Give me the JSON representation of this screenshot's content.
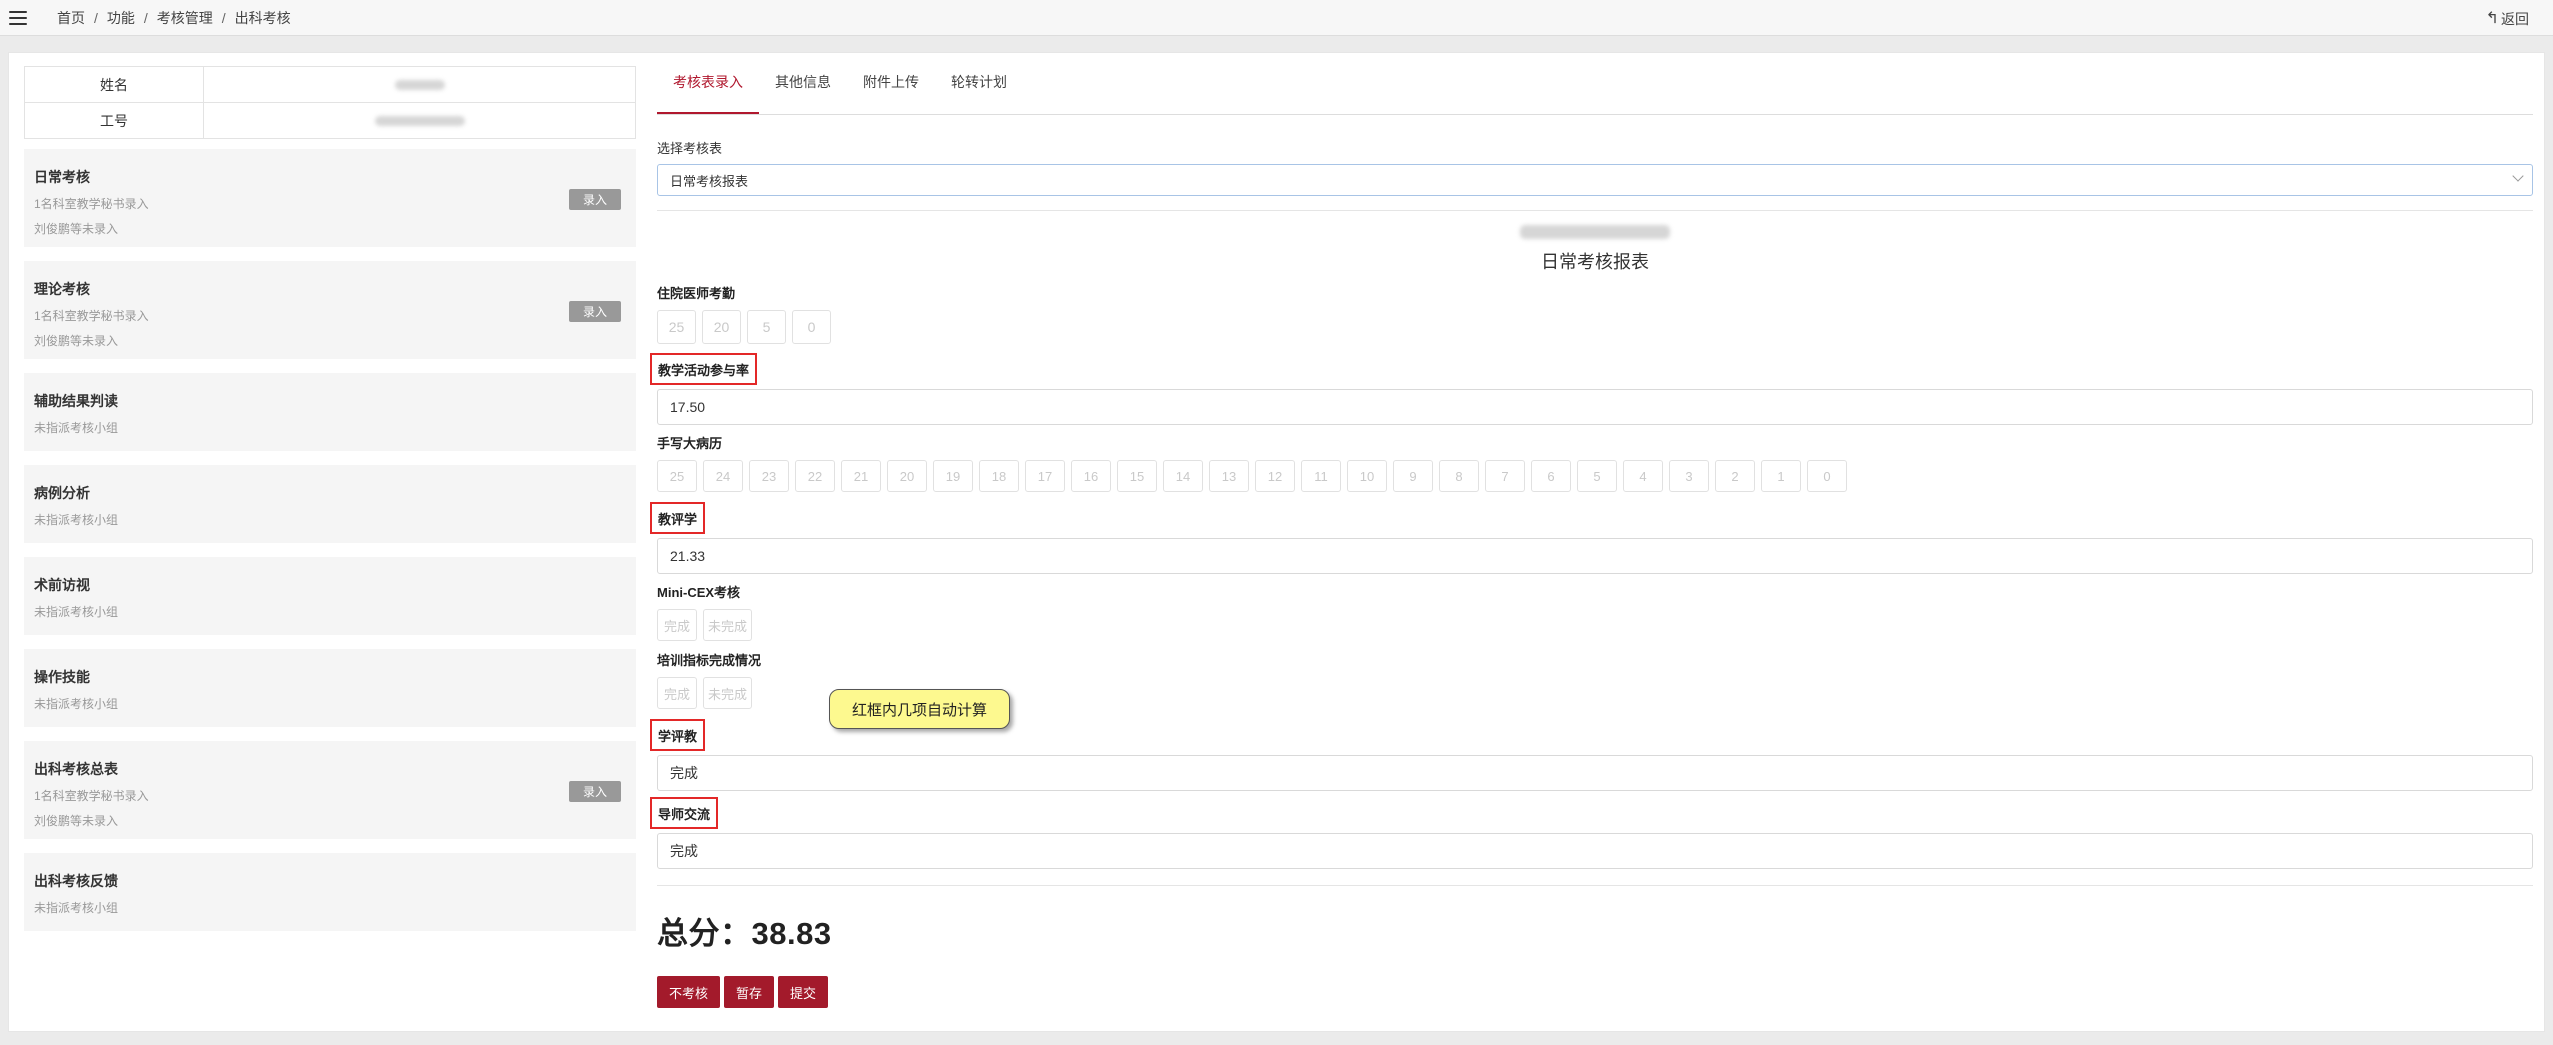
{
  "breadcrumb": [
    "首页",
    "功能",
    "考核管理",
    "出科考核"
  ],
  "back_label": "返回",
  "student": {
    "name_label": "姓名",
    "id_label": "工号"
  },
  "modules": [
    {
      "title": "日常考核",
      "lines": [
        "1名科室教学秘书录入",
        "刘俊鹏等未录入"
      ],
      "button": "录入"
    },
    {
      "title": "理论考核",
      "lines": [
        "1名科室教学秘书录入",
        "刘俊鹏等未录入"
      ],
      "button": "录入"
    },
    {
      "title": "辅助结果判读",
      "lines": [
        "未指派考核小组"
      ]
    },
    {
      "title": "病例分析",
      "lines": [
        "未指派考核小组"
      ]
    },
    {
      "title": "术前访视",
      "lines": [
        "未指派考核小组"
      ]
    },
    {
      "title": "操作技能",
      "lines": [
        "未指派考核小组"
      ]
    },
    {
      "title": "出科考核总表",
      "lines": [
        "1名科室教学秘书录入",
        "刘俊鹏等未录入"
      ],
      "button": "录入"
    },
    {
      "title": "出科考核反馈",
      "lines": [
        "未指派考核小组"
      ]
    }
  ],
  "tabs": [
    "考核表录入",
    "其他信息",
    "附件上传",
    "轮转计划"
  ],
  "select_label": "选择考核表",
  "select_value": "日常考核报表",
  "report_title": "日常考核报表",
  "fields": {
    "attendance": {
      "label": "住院医师考勤",
      "options": [
        "25",
        "20",
        "5",
        "0"
      ]
    },
    "teaching_rate": {
      "label": "教学活动参与率",
      "value": "17.50"
    },
    "records": {
      "label": "手写大病历",
      "options": [
        "25",
        "24",
        "23",
        "22",
        "21",
        "20",
        "19",
        "18",
        "17",
        "16",
        "15",
        "14",
        "13",
        "12",
        "11",
        "10",
        "9",
        "8",
        "7",
        "6",
        "5",
        "4",
        "3",
        "2",
        "1",
        "0"
      ]
    },
    "teacher_eval": {
      "label": "教评学",
      "value": "21.33"
    },
    "mini_cex": {
      "label": "Mini-CEX考核",
      "options": [
        "完成",
        "未完成"
      ]
    },
    "training": {
      "label": "培训指标完成情况",
      "options": [
        "完成",
        "未完成"
      ]
    },
    "student_eval": {
      "label": "学评教",
      "value": "完成"
    },
    "mentor": {
      "label": "导师交流",
      "value": "完成"
    }
  },
  "tooltip": "红框内几项自动计算",
  "total": "总分：38.83",
  "buttons": {
    "skip": "不考核",
    "save": "暂存",
    "submit": "提交"
  },
  "colors": {
    "accent": "#b0182e",
    "button_red": "#a31a2b",
    "highlight_box": "#e32828",
    "tooltip_bg": "#fdf98f"
  }
}
